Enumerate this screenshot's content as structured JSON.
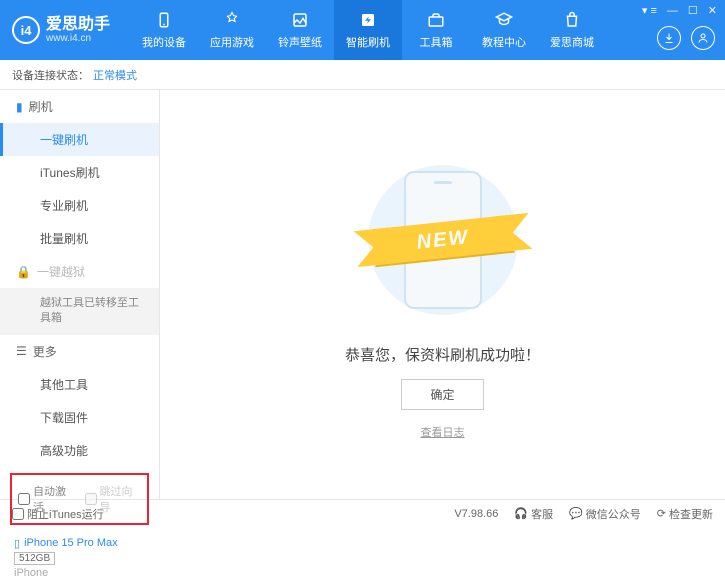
{
  "app": {
    "title": "爱思助手",
    "subtitle": "www.i4.cn"
  },
  "nav": {
    "items": [
      {
        "label": "我的设备"
      },
      {
        "label": "应用游戏"
      },
      {
        "label": "铃声壁纸"
      },
      {
        "label": "智能刷机"
      },
      {
        "label": "工具箱"
      },
      {
        "label": "教程中心"
      },
      {
        "label": "爱思商城"
      }
    ],
    "active_index": 3
  },
  "status": {
    "label": "设备连接状态：",
    "value": "正常模式"
  },
  "sidebar": {
    "flash_section": "刷机",
    "items": {
      "one_click": "一键刷机",
      "itunes": "iTunes刷机",
      "pro": "专业刷机",
      "batch": "批量刷机"
    },
    "jailbreak_section": "一键越狱",
    "jailbreak_note": "越狱工具已转移至工具箱",
    "more_section": "更多",
    "more": {
      "other_tools": "其他工具",
      "download_fw": "下载固件",
      "advanced": "高级功能"
    },
    "opts": {
      "auto_activate": "自动激活",
      "skip_guide": "跳过向导"
    }
  },
  "device": {
    "name": "iPhone 15 Pro Max",
    "capacity": "512GB",
    "type": "iPhone"
  },
  "main": {
    "ribbon": "NEW",
    "message": "恭喜您，保资料刷机成功啦！",
    "ok": "确定",
    "view_log": "查看日志"
  },
  "footer": {
    "block_itunes": "阻止iTunes运行",
    "version": "V7.98.66",
    "support": "客服",
    "wechat": "微信公众号",
    "check_update": "检查更新"
  }
}
